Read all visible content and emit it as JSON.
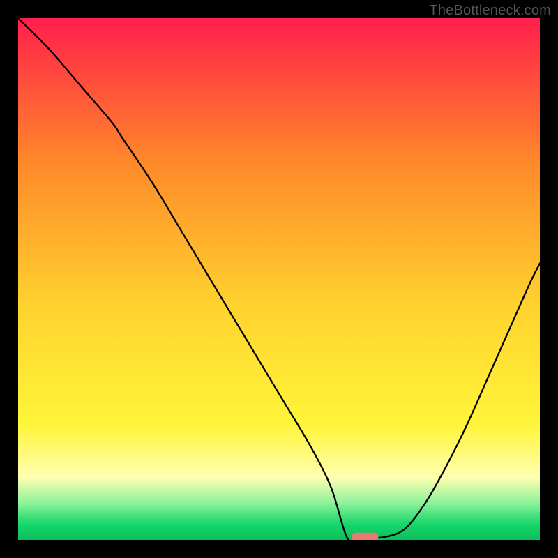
{
  "watermark": "TheBottleneck.com",
  "chart_data": {
    "type": "line",
    "title": "",
    "xlabel": "",
    "ylabel": "",
    "xlim": [
      0,
      100
    ],
    "ylim": [
      0,
      100
    ],
    "grid": false,
    "legend": false,
    "series": [
      {
        "name": "bottleneck-curve",
        "x": [
          0,
          6,
          12,
          18,
          20,
          26,
          32,
          38,
          44,
          50,
          56,
          60,
          63,
          65,
          67,
          70,
          74,
          78,
          82,
          86,
          90,
          94,
          98,
          100
        ],
        "y": [
          100,
          94,
          87,
          80,
          77,
          68,
          58,
          48,
          38,
          28,
          18,
          10,
          5,
          2,
          0.5,
          0.5,
          2,
          7,
          14,
          22,
          31,
          40,
          49,
          53
        ],
        "flat_segment_x": [
          63,
          70
        ],
        "marker": {
          "x": 66.5,
          "y": 0.5
        }
      }
    ],
    "background_gradient": {
      "top": "#ff1f4b",
      "mid_upper": "#ff8a2a",
      "mid": "#ffd22e",
      "mid_lower": "#fff53a",
      "pale_band": "#ffffb0",
      "green_light": "#8cf29a",
      "green": "#17d66a",
      "green_deep": "#0bbf5d"
    }
  }
}
